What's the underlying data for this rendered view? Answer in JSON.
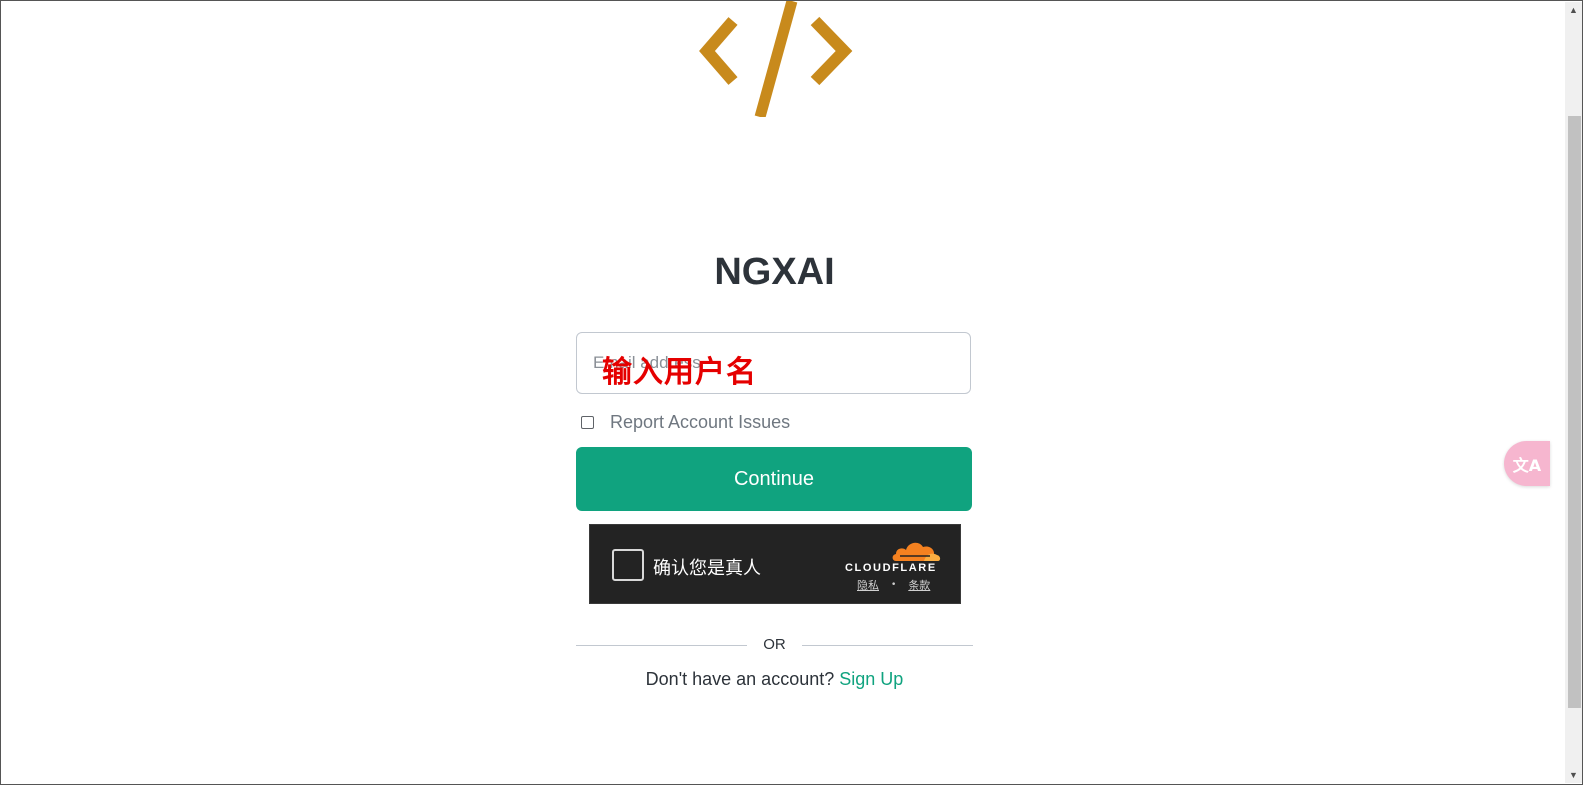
{
  "brand": {
    "title": "NGXAI",
    "logo_icon": "code-brackets-icon",
    "logo_color": "#c88a1c"
  },
  "login": {
    "username_placeholder": "Email address",
    "username_overlay": "输入用户名",
    "report_label": "Report Account Issues",
    "continue_label": "Continue",
    "or_label": "OR",
    "signup_prompt": "Don't have an account?",
    "signup_link": "Sign Up"
  },
  "captcha": {
    "label": "确认您是真人",
    "provider": "CLOUDFLARE",
    "privacy_link": "隐私",
    "terms_link": "条款",
    "separator": "•"
  },
  "translate_widget": {
    "icon": "translate-icon",
    "label": "文A"
  },
  "colors": {
    "accent": "#10a37f",
    "overlay_text": "#e50000",
    "captcha_bg": "#232323",
    "cloud": "#f48120"
  }
}
